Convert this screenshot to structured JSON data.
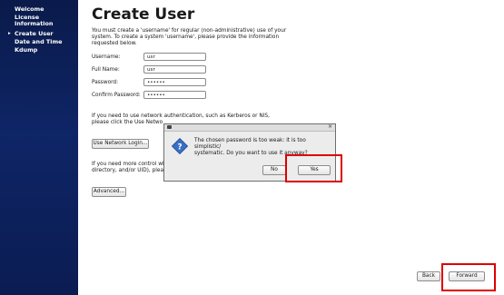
{
  "sidebar": {
    "items": [
      {
        "label": "Welcome",
        "active": false
      },
      {
        "label": "License",
        "active": false
      },
      {
        "label": "Information",
        "active": false
      },
      {
        "label": "Create User",
        "active": true
      },
      {
        "label": "Date and Time",
        "active": false
      },
      {
        "label": "Kdump",
        "active": false
      }
    ],
    "active_marker": "▸"
  },
  "main": {
    "title": "Create User",
    "intro_line1": "You must create a 'username' for regular (non-administrative) use of your",
    "intro_line2": "system.  To create a system 'username', please provide the information",
    "intro_line3": "requested below.",
    "fields": {
      "username": {
        "label": "Username:",
        "value": "usr"
      },
      "full_name": {
        "label": "Full Name:",
        "value": "usr"
      },
      "password": {
        "label": "Password:",
        "value": "••••••"
      },
      "confirm_password": {
        "label": "Confirm Password:",
        "value": "••••••"
      }
    },
    "network_para_line1": "If you need to use network authentication, such as Kerberos or NIS,",
    "network_para_line2": "please click the Use Netwo",
    "use_network_login_label": "Use Network Login...",
    "advanced_para_line1": "If you need more control wh",
    "advanced_para_line2": "directory, and/or UID), pleas",
    "advanced_label": "Advanced..."
  },
  "footer": {
    "back_label": "Back",
    "forward_label": "Forward"
  },
  "dialog": {
    "close_glyph": "×",
    "message_line1": "The chosen password is too weak: it is too simplistic/",
    "message_line2": "systematic.  Do you want to use it anyway?",
    "no_label": "No",
    "yes_label": "Yes"
  },
  "colors": {
    "sidebar_bg": "#0e2566",
    "highlight": "#dd0000",
    "dialog_icon": "#3a6fc4"
  }
}
